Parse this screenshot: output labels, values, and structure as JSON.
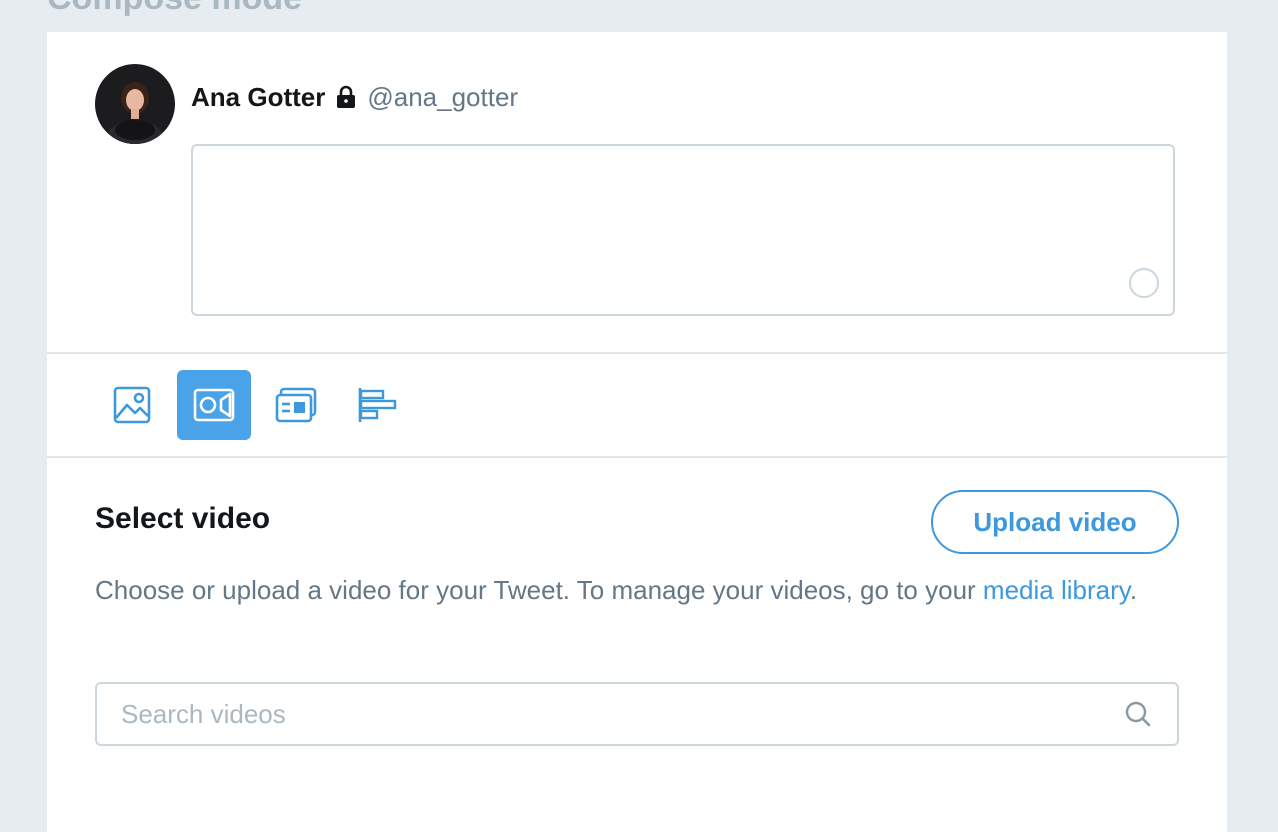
{
  "page": {
    "heading": "Compose mode"
  },
  "composer": {
    "user": {
      "name": "Ana Gotter",
      "handle": "@ana_gotter",
      "protected_icon": "lock-icon",
      "avatar_icon": "user-avatar"
    },
    "tweet_text": ""
  },
  "toolbar": {
    "items": [
      {
        "name": "image",
        "icon": "image-icon",
        "active": false
      },
      {
        "name": "video",
        "icon": "video-icon",
        "active": true
      },
      {
        "name": "card",
        "icon": "card-icon",
        "active": false
      },
      {
        "name": "poll",
        "icon": "poll-icon",
        "active": false
      }
    ],
    "active_color": "#4aa3e8",
    "icon_color": "#3d98dd"
  },
  "video_section": {
    "title": "Select video",
    "upload_button": "Upload video",
    "description_prefix": "Choose or upload a video for your Tweet. To manage your videos, go to your ",
    "media_link": "media library",
    "description_suffix": ".",
    "search": {
      "placeholder": "Search videos",
      "value": ""
    }
  }
}
